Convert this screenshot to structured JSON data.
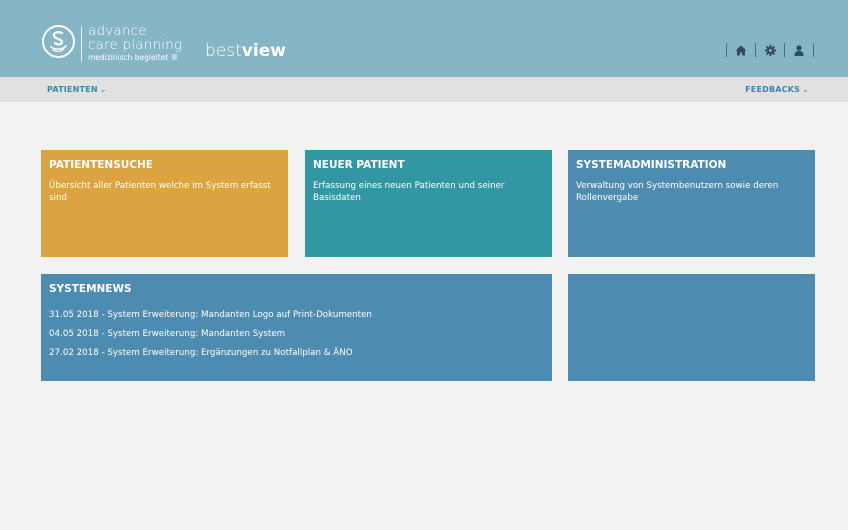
{
  "header": {
    "logo": {
      "line1": "advance",
      "line2": "care planning",
      "line3": "medizinisch begleitet ®"
    },
    "brand": {
      "part1": "best",
      "part2": "view"
    },
    "icons": [
      "home-icon",
      "gear-icon",
      "user-icon"
    ]
  },
  "nav": {
    "left": {
      "label": "PATIENTEN",
      "chevron": "⌄"
    },
    "right": {
      "label": "FEEDBACKS",
      "chevron": "⌄"
    }
  },
  "tiles": {
    "patientensuche": {
      "title": "PATIENTENSUCHE",
      "desc": "Übersicht aller Patienten welche im System erfasst sind",
      "color": "#dba342"
    },
    "neuer_patient": {
      "title": "NEUER PATIENT",
      "desc": "Erfassung eines neuen Patienten und seiner Basisdaten",
      "color": "#3397a3"
    },
    "systemadministration": {
      "title": "SYSTEMADMINISTRATION",
      "desc": "Verwaltung von Systembenutzern sowie deren Rollenvergabe",
      "color": "#4d8cb0"
    },
    "systemnews": {
      "title": "SYSTEMNEWS",
      "items": [
        "31.05 2018  -  System Erweiterung: Mandanten Logo auf Print-Dokumenten",
        "04.05 2018  -  System Erweiterung: Mandanten System",
        "27.02 2018  -  System Erweiterung: Ergänzungen zu Notfallplan & ÄNO"
      ],
      "color": "#4d8cb0"
    },
    "empty": {
      "color": "#4d8cb0"
    }
  },
  "colors": {
    "header_bg": "#86b5c6",
    "nav_bg": "#e1e1e1",
    "nav_text": "#3a86aa",
    "page_bg": "#f2f2f2"
  }
}
